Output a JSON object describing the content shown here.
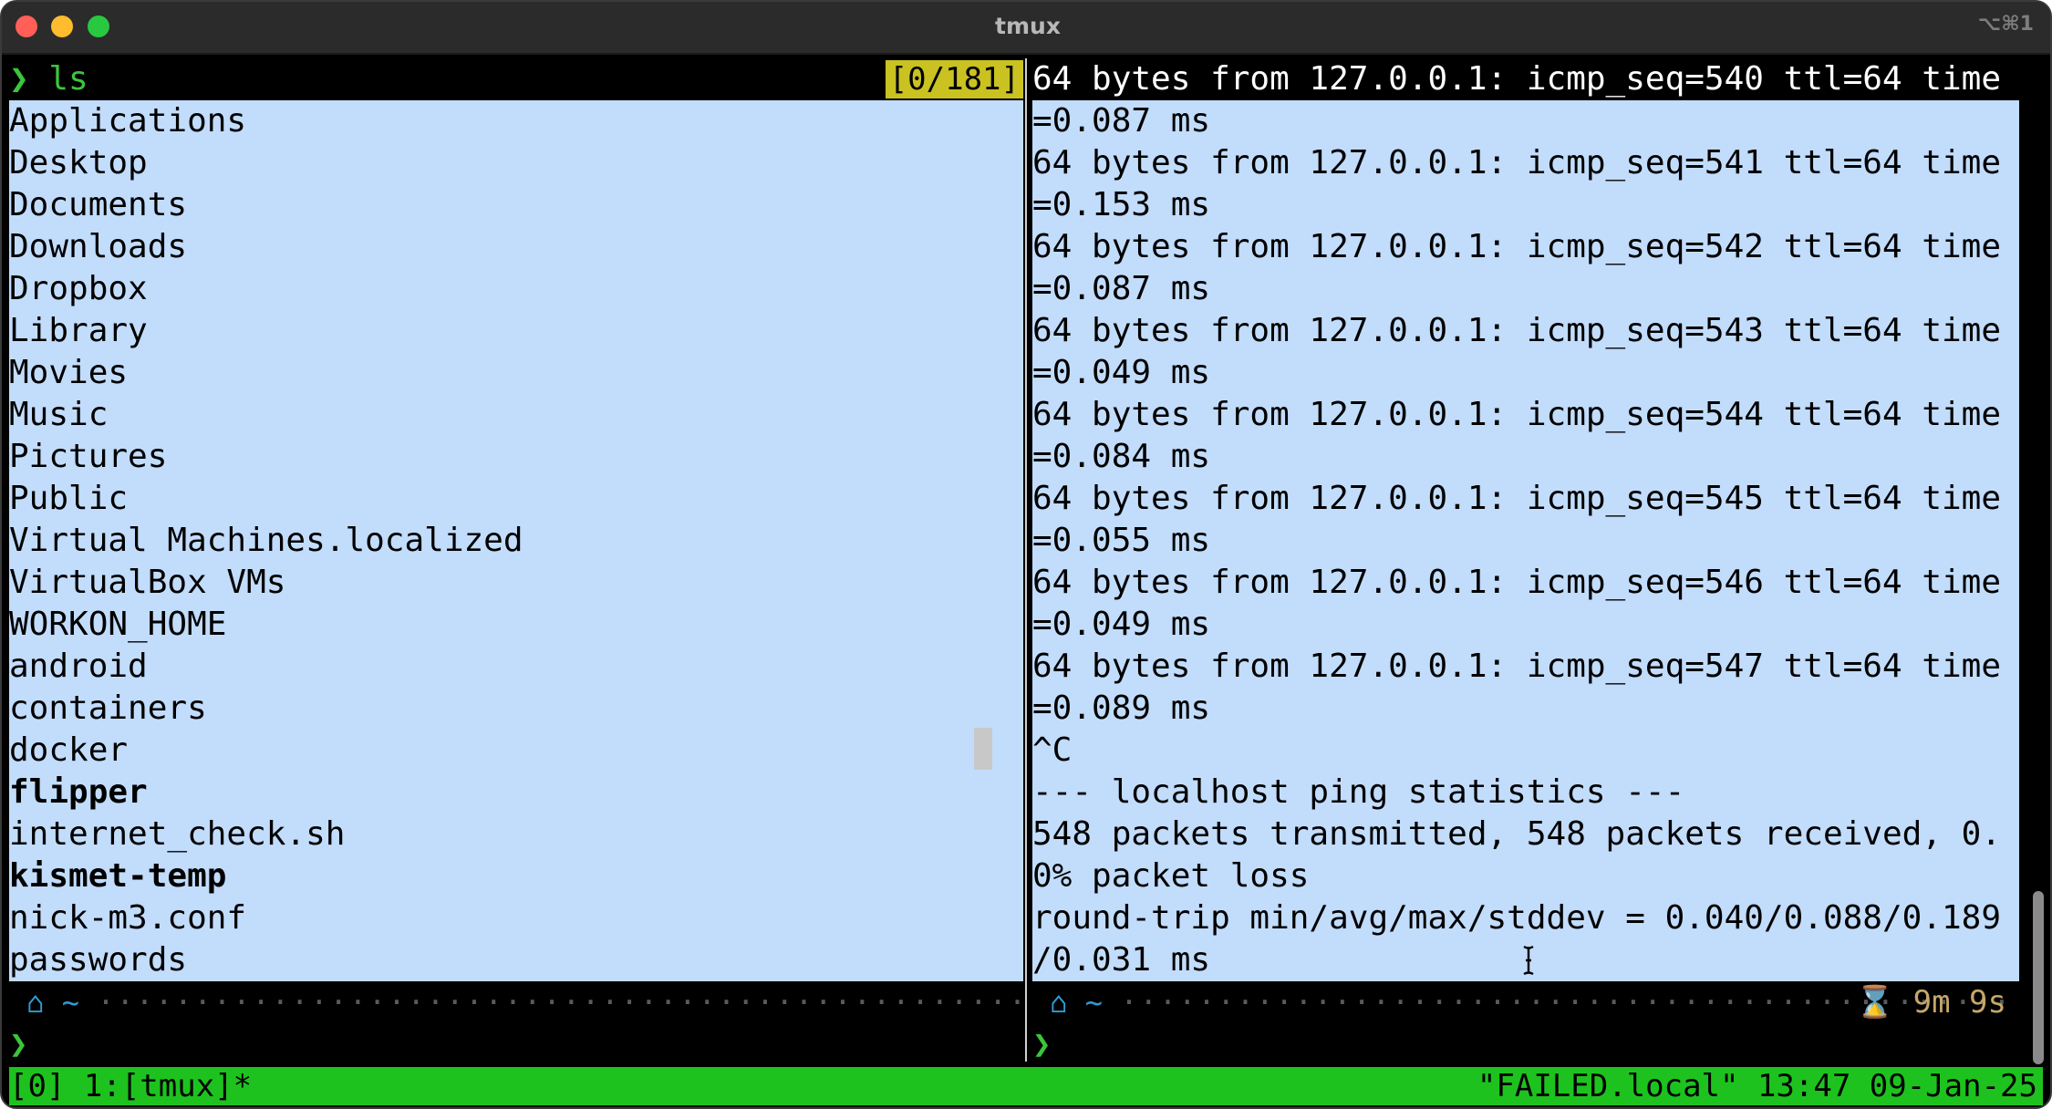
{
  "window": {
    "title": "tmux",
    "shortcut": "⌥⌘1",
    "controls": [
      "close",
      "minimize",
      "zoom"
    ]
  },
  "left_pane": {
    "prompt_symbol": "❯",
    "command": "ls",
    "scroll_counter": "[0/181]",
    "entries": [
      {
        "text": "Applications",
        "bold": false
      },
      {
        "text": "Desktop",
        "bold": false
      },
      {
        "text": "Documents",
        "bold": false
      },
      {
        "text": "Downloads",
        "bold": false
      },
      {
        "text": "Dropbox",
        "bold": false
      },
      {
        "text": "Library",
        "bold": false
      },
      {
        "text": "Movies",
        "bold": false
      },
      {
        "text": "Music",
        "bold": false
      },
      {
        "text": "Pictures",
        "bold": false
      },
      {
        "text": "Public",
        "bold": false
      },
      {
        "text": "Virtual Machines.localized",
        "bold": false
      },
      {
        "text": "VirtualBox VMs",
        "bold": false
      },
      {
        "text": "WORKON_HOME",
        "bold": false
      },
      {
        "text": "android",
        "bold": false
      },
      {
        "text": "containers",
        "bold": false
      },
      {
        "text": "docker",
        "bold": false
      },
      {
        "text": "flipper",
        "bold": true
      },
      {
        "text": "internet_check.sh",
        "bold": false
      },
      {
        "text": "kismet-temp",
        "bold": true
      },
      {
        "text": "nick-m3.conf",
        "bold": false
      },
      {
        "text": "passwords",
        "bold": false
      }
    ],
    "status": {
      "apple_icon": "",
      "home_icon": "⌂",
      "dir": "~"
    },
    "prompt": "❯"
  },
  "right_pane": {
    "lines": [
      "64 bytes from 127.0.0.1: icmp_seq=540 ttl=64 time",
      "=0.087 ms",
      "64 bytes from 127.0.0.1: icmp_seq=541 ttl=64 time",
      "=0.153 ms",
      "64 bytes from 127.0.0.1: icmp_seq=542 ttl=64 time",
      "=0.087 ms",
      "64 bytes from 127.0.0.1: icmp_seq=543 ttl=64 time",
      "=0.049 ms",
      "64 bytes from 127.0.0.1: icmp_seq=544 ttl=64 time",
      "=0.084 ms",
      "64 bytes from 127.0.0.1: icmp_seq=545 ttl=64 time",
      "=0.055 ms",
      "64 bytes from 127.0.0.1: icmp_seq=546 ttl=64 time",
      "=0.049 ms",
      "64 bytes from 127.0.0.1: icmp_seq=547 ttl=64 time",
      "=0.089 ms",
      "^C",
      "--- localhost ping statistics ---",
      "548 packets transmitted, 548 packets received, 0.",
      "0% packet loss",
      "round-trip min/avg/max/stddev = 0.040/0.088/0.189",
      "/0.031 ms"
    ],
    "status": {
      "apple_icon": "",
      "home_icon": "⌂",
      "dir": "~",
      "timer_icon": "⌛",
      "duration": "9m 9s"
    },
    "prompt": "❯"
  },
  "tmux_status": {
    "left": "[0] 1:[tmux]*",
    "right": "\"FAILED.local\" 13:47 09-Jan-25"
  },
  "colors": {
    "selection": "#c2dcfb",
    "prompt_green": "#3cc53c",
    "tmux_bar": "#1ec21e",
    "counter_bg": "#c9c221"
  }
}
